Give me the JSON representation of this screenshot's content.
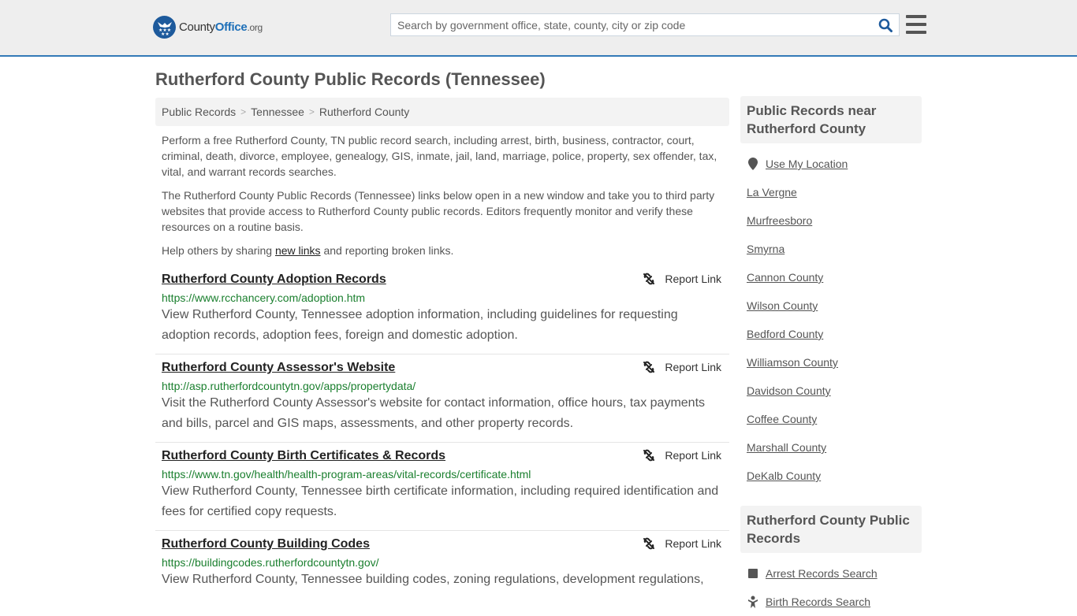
{
  "header": {
    "logo": {
      "county": "County",
      "office": "Office",
      "org": ".org"
    },
    "search": {
      "placeholder": "Search by government office, state, county, city or zip code",
      "value": ""
    },
    "colors": {
      "accent": "#337ab7",
      "brand": "#1d5a9c",
      "url_green": "#1a7f2e"
    }
  },
  "page": {
    "title": "Rutherford County Public Records (Tennessee)"
  },
  "breadcrumb": [
    {
      "label": "Public Records"
    },
    {
      "label": "Tennessee"
    },
    {
      "label": "Rutherford County"
    }
  ],
  "breadcrumb_sep": ">",
  "intro": {
    "p1": "Perform a free Rutherford County, TN public record search, including arrest, birth, business, contractor, court, criminal, death, divorce, employee, genealogy, GIS, inmate, jail, land, marriage, police, property, sex offender, tax, vital, and warrant records searches.",
    "p2": "The Rutherford County Public Records (Tennessee) links below open in a new window and take you to third party websites that provide access to Rutherford County public records. Editors frequently monitor and verify these resources on a routine basis.",
    "p3_before": "Help others by sharing ",
    "p3_link": "new links",
    "p3_after": " and reporting broken links."
  },
  "report_label": "Report Link",
  "records": [
    {
      "title": "Rutherford County Adoption Records",
      "url": "https://www.rcchancery.com/adoption.htm",
      "desc": "View Rutherford County, Tennessee adoption information, including guidelines for requesting adoption records, adoption fees, foreign and domestic adoption."
    },
    {
      "title": "Rutherford County Assessor's Website",
      "url": "http://asp.rutherfordcountytn.gov/apps/propertydata/",
      "desc": "Visit the Rutherford County Assessor's website for contact information, office hours, tax payments and bills, parcel and GIS maps, assessments, and other property records."
    },
    {
      "title": "Rutherford County Birth Certificates & Records",
      "url": "https://www.tn.gov/health/health-program-areas/vital-records/certificate.html",
      "desc": "View Rutherford County, Tennessee birth certificate information, including required identification and fees for certified copy requests."
    },
    {
      "title": "Rutherford County Building Codes",
      "url": "https://buildingcodes.rutherfordcountytn.gov/",
      "desc": "View Rutherford County, Tennessee building codes, zoning regulations, development regulations,"
    }
  ],
  "sidebar": {
    "near": {
      "heading": "Public Records near Rutherford County",
      "use_location": "Use My Location",
      "items": [
        "La Vergne",
        "Murfreesboro",
        "Smyrna",
        "Cannon County",
        "Wilson County",
        "Bedford County",
        "Williamson County",
        "Davidson County",
        "Coffee County",
        "Marshall County",
        "DeKalb County"
      ]
    },
    "records": {
      "heading": "Rutherford County Public Records",
      "items": [
        {
          "label": "Arrest Records Search",
          "icon": "arrest-icon"
        },
        {
          "label": "Birth Records Search",
          "icon": "baby-icon"
        }
      ]
    }
  }
}
